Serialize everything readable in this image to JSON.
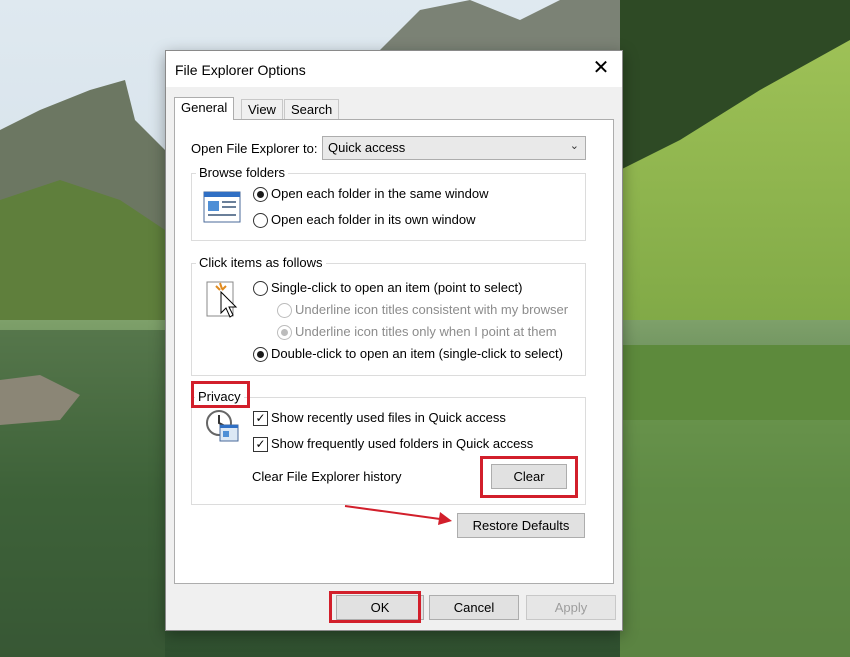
{
  "dialog": {
    "title": "File Explorer Options",
    "close_glyph": "✕",
    "tabs": [
      {
        "label": "General"
      },
      {
        "label": "View"
      },
      {
        "label": "Search"
      }
    ],
    "active_tab": "General"
  },
  "general": {
    "open_to_label": "Open File Explorer to:",
    "open_to_value": "Quick access",
    "browse_folders": {
      "title": "Browse folders",
      "options": [
        {
          "label": "Open each folder in the same window",
          "selected": true
        },
        {
          "label": "Open each folder in its own window",
          "selected": false
        }
      ]
    },
    "click_items": {
      "title": "Click items as follows",
      "single_click": "Single-click to open an item (point to select)",
      "underline_browser": "Underline icon titles consistent with my browser",
      "underline_point": "Underline icon titles only when I point at them",
      "double_click": "Double-click to open an item (single-click to select)"
    },
    "privacy": {
      "title": "Privacy",
      "recent_files": "Show recently used files in Quick access",
      "frequent_folders": "Show frequently used folders in Quick access",
      "clear_history_label": "Clear File Explorer history",
      "clear_button": "Clear"
    },
    "restore_defaults": "Restore Defaults"
  },
  "footer": {
    "ok": "OK",
    "cancel": "Cancel",
    "apply": "Apply"
  },
  "colors": {
    "highlight": "#d21f2b",
    "dialog_bg": "#f0f0f0"
  }
}
